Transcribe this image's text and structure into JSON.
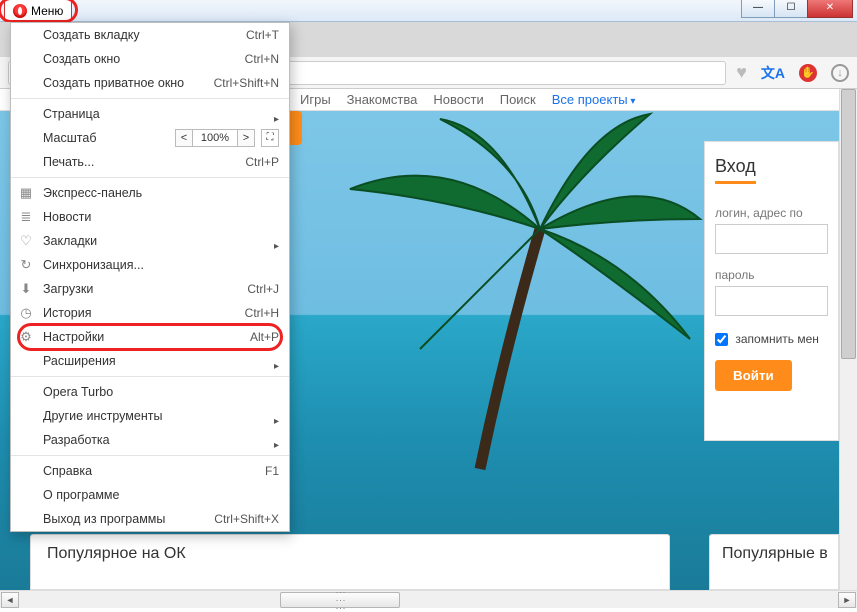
{
  "menu_button": "Меню",
  "menu": {
    "new_tab": {
      "label": "Создать вкладку",
      "shortcut": "Ctrl+T"
    },
    "new_window": {
      "label": "Создать окно",
      "shortcut": "Ctrl+N"
    },
    "new_private": {
      "label": "Создать приватное окно",
      "shortcut": "Ctrl+Shift+N"
    },
    "page": {
      "label": "Страница"
    },
    "zoom": {
      "label": "Масштаб",
      "value": "100%"
    },
    "print": {
      "label": "Печать...",
      "shortcut": "Ctrl+P"
    },
    "speed_dial": {
      "label": "Экспресс-панель"
    },
    "news": {
      "label": "Новости"
    },
    "bookmarks": {
      "label": "Закладки"
    },
    "sync": {
      "label": "Синхронизация..."
    },
    "downloads": {
      "label": "Загрузки",
      "shortcut": "Ctrl+J"
    },
    "history": {
      "label": "История",
      "shortcut": "Ctrl+H"
    },
    "settings": {
      "label": "Настройки",
      "shortcut": "Alt+P"
    },
    "extensions": {
      "label": "Расширения"
    },
    "turbo": {
      "label": "Opera Turbo"
    },
    "other_tools": {
      "label": "Другие инструменты"
    },
    "developer": {
      "label": "Разработка"
    },
    "help": {
      "label": "Справка",
      "shortcut": "F1"
    },
    "about": {
      "label": "О программе"
    },
    "exit": {
      "label": "Выход из программы",
      "shortcut": "Ctrl+Shift+X"
    }
  },
  "nav": {
    "games": "Игры",
    "dating": "Знакомства",
    "news": "Новости",
    "search": "Поиск",
    "all": "Все проекты"
  },
  "login": {
    "title": "Вход",
    "login_label": "логин, адрес по",
    "password_label": "пароль",
    "remember": "запомнить мен",
    "submit": "Войти"
  },
  "popular": {
    "title": "Популярное на ОК"
  },
  "popular2": {
    "title": "Популярные в"
  },
  "win": {
    "min": "—",
    "max": "☐",
    "close": "✕"
  }
}
